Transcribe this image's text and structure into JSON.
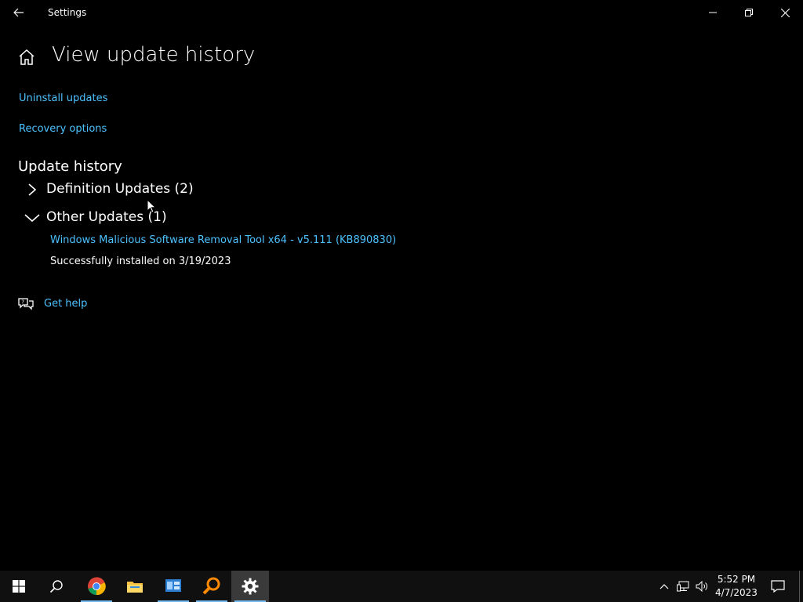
{
  "window": {
    "title": "Settings"
  },
  "page": {
    "title": "View update history"
  },
  "links": {
    "uninstall": "Uninstall updates",
    "recovery": "Recovery options",
    "help": "Get help"
  },
  "history": {
    "title": "Update history",
    "groups": [
      {
        "label": "Definition Updates (2)",
        "expanded": false
      },
      {
        "label": "Other Updates (1)",
        "expanded": true,
        "items": [
          {
            "name": "Windows Malicious Software Removal Tool x64 - v5.111 (KB890830)",
            "status": "Successfully installed on 3/19/2023"
          }
        ]
      }
    ]
  },
  "taskbar": {
    "time": "5:52 PM",
    "date": "4/7/2023",
    "pinned": [
      "windows-start-icon",
      "search-icon",
      "chrome-icon",
      "file-explorer-icon",
      "control-panel-icon",
      "magnifier-app-icon",
      "settings-gear-icon"
    ]
  },
  "colors": {
    "accent_link": "#4cc2ff",
    "background": "#000000",
    "taskbar": "#101010"
  }
}
